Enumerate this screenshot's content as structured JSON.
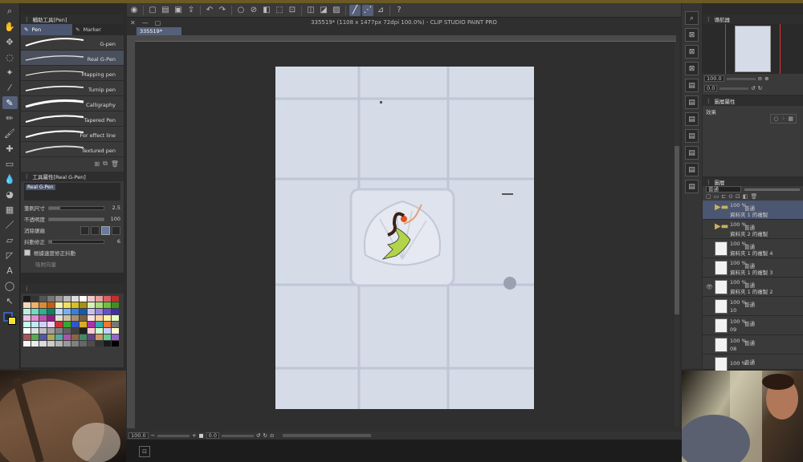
{
  "app": {
    "window_title": "335519* (1108 x 1477px 72dpi 100.0%) - CLIP STUDIO PAINT PRO",
    "doc_tab": "335519*"
  },
  "subtool": {
    "title": "輔助工具[Pen]",
    "tabs": [
      "Pen",
      "Marker"
    ],
    "brushes": [
      "G-pen",
      "Real G-Pen",
      "Mapping pen",
      "Turnip pen",
      "Calligraphy",
      "Tapered Pen",
      "For effect line",
      "Textured pen"
    ],
    "selected": "Real G-Pen"
  },
  "toolprop": {
    "title": "工具屬性[Real G-Pen]",
    "preview_label": "Real G-Pen",
    "brush_size_label": "筆刷尺寸",
    "brush_size_value": "2.5",
    "opacity_label": "不透明度",
    "opacity_value": "100",
    "antialias_label": "消除鋸齒",
    "stabilization_label": "抖動修正",
    "stabilization_value": "6",
    "speed_label": "根據速度修正抖動",
    "vector_label": "吸附向量"
  },
  "palette": {
    "colors": [
      "#1a1a1a",
      "#333333",
      "#555555",
      "#777777",
      "#999999",
      "#bbbbbb",
      "#dddddd",
      "#ffffff",
      "#f2c8c8",
      "#e8a0a0",
      "#d96060",
      "#c03030",
      "#f5d7b5",
      "#f0b070",
      "#e08a30",
      "#c06010",
      "#f7f0b0",
      "#f0e060",
      "#d8c020",
      "#a89010",
      "#d8f0b8",
      "#a8dc78",
      "#70c040",
      "#409020",
      "#b8f0e0",
      "#70dcc0",
      "#30b090",
      "#108060",
      "#b8d8f5",
      "#78b0ec",
      "#3880d8",
      "#1858a8",
      "#c8c0f0",
      "#9888e0",
      "#6850c8",
      "#4030a0",
      "#f0c0e8",
      "#e090d0",
      "#c050b0",
      "#902080",
      "#e8e0d0",
      "#d0c0a0",
      "#a89070",
      "#786040",
      "#ffe0e0",
      "#ffd0a0",
      "#fff0a0",
      "#e0ffc0",
      "#c0ffe8",
      "#c0e8ff",
      "#d0d0ff",
      "#ffd0f0",
      "#cc3333",
      "#33aa33",
      "#3355cc",
      "#ddaa22",
      "#aa33aa",
      "#33aaaa",
      "#ee7733",
      "#777777",
      "#ffffff",
      "#e0e0e0",
      "#c0c0c0",
      "#a0a0a0",
      "#808080",
      "#606060",
      "#404040",
      "#202020",
      "#ffcccc",
      "#ccffcc",
      "#ccccff",
      "#ffffcc",
      "#aa5555",
      "#55aa55",
      "#5555aa",
      "#aaaa55",
      "#55aaaa",
      "#aa55aa",
      "#886644",
      "#448866",
      "#664488",
      "#cc9966",
      "#66cc99",
      "#9966cc",
      "#f5f5f5",
      "#ebebeb",
      "#dcdcdc",
      "#cccccc",
      "#b3b3b3",
      "#999999",
      "#808080",
      "#666666",
      "#4d4d4d",
      "#333333",
      "#1a1a1a",
      "#000000"
    ]
  },
  "canvas": {
    "zoom": "100.0",
    "rotation": "0.0"
  },
  "navigator": {
    "title": "導航器",
    "zoom": "100.0",
    "rotation": "0.0"
  },
  "layerprop": {
    "title": "圖層屬性",
    "effect_label": "效果"
  },
  "layers": {
    "title": "圖層",
    "blend_mode": "普通",
    "opacity": "100",
    "items": [
      {
        "pct": "100 %",
        "mode": "普通",
        "name": "資料夾 1 的複製",
        "folder": true,
        "sel": true
      },
      {
        "pct": "100 %",
        "mode": "普通",
        "name": "資料夾 2 的複製",
        "folder": true,
        "sel": false
      },
      {
        "pct": "100 %",
        "mode": "普通",
        "name": "資料夾 1 的複製 4",
        "folder": false,
        "sel": false
      },
      {
        "pct": "100 %",
        "mode": "普通",
        "name": "資料夾 1 的複製 3",
        "folder": false,
        "sel": false
      },
      {
        "pct": "100 %",
        "mode": "普通",
        "name": "資料夾 1 的複製 2",
        "folder": false,
        "sel": false
      },
      {
        "pct": "100 %",
        "mode": "普通",
        "name": "10",
        "folder": false,
        "sel": false
      },
      {
        "pct": "100 %",
        "mode": "普通",
        "name": "09",
        "folder": false,
        "sel": false
      },
      {
        "pct": "100 %",
        "mode": "普通",
        "name": "08",
        "folder": false,
        "sel": false
      },
      {
        "pct": "100 %",
        "mode": "普通",
        "name": "",
        "folder": false,
        "sel": false
      }
    ]
  }
}
